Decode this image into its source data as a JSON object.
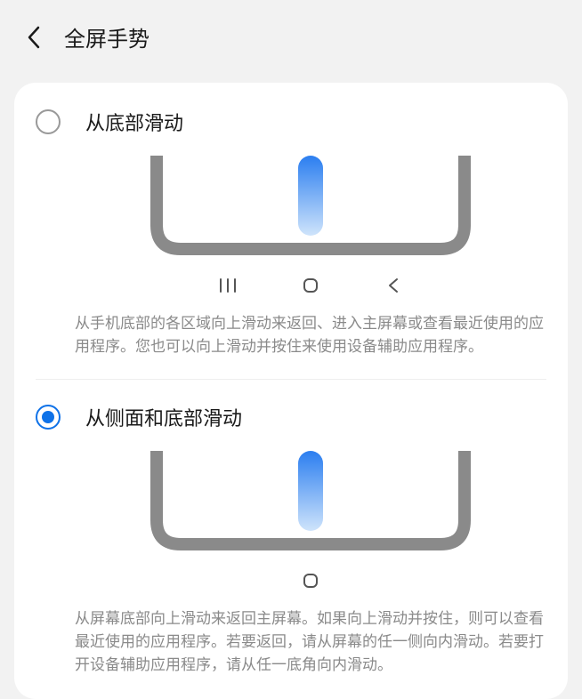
{
  "header": {
    "title": "全屏手势"
  },
  "options": [
    {
      "title": "从底部滑动",
      "selected": false,
      "three_icons": true,
      "description": "从手机底部的各区域向上滑动来返回、进入主屏幕或查看最近使用的应用程序。您也可以向上滑动并按住来使用设备辅助应用程序。"
    },
    {
      "title": "从侧面和底部滑动",
      "selected": true,
      "three_icons": false,
      "description": "从屏幕底部向上滑动来返回主屏幕。如果向上滑动并按住，则可以查看最近使用的应用程序。若要返回，请从屏幕的任一侧向内滑动。若要打开设备辅助应用程序，请从任一底角向内滑动。"
    }
  ]
}
